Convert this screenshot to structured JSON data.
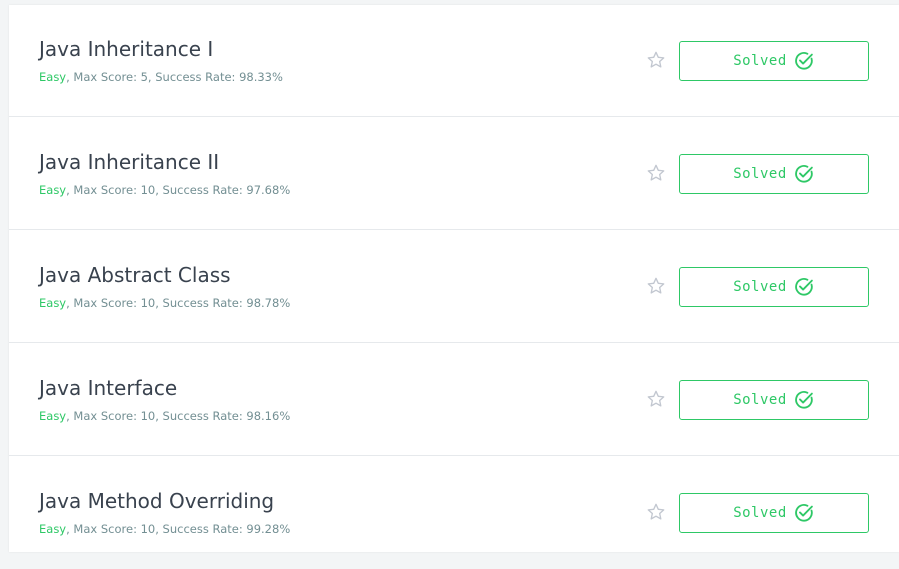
{
  "challenges": [
    {
      "title": "Java Inheritance I",
      "difficulty": "Easy",
      "details": ", Max Score: 5, Success Rate: 98.33%",
      "button_label": "Solved"
    },
    {
      "title": "Java Inheritance II",
      "difficulty": "Easy",
      "details": ", Max Score: 10, Success Rate: 97.68%",
      "button_label": "Solved"
    },
    {
      "title": "Java Abstract Class",
      "difficulty": "Easy",
      "details": ", Max Score: 10, Success Rate: 98.78%",
      "button_label": "Solved"
    },
    {
      "title": "Java Interface",
      "difficulty": "Easy",
      "details": ", Max Score: 10, Success Rate: 98.16%",
      "button_label": "Solved"
    },
    {
      "title": "Java Method Overriding",
      "difficulty": "Easy",
      "details": ", Max Score: 10, Success Rate: 99.28%",
      "button_label": "Solved"
    }
  ],
  "icons": {
    "star": "star-outline-icon",
    "check": "check-circle-icon"
  },
  "colors": {
    "accent": "#2ec866",
    "title": "#39424e",
    "meta": "#738f93",
    "star": "#c2c7d0",
    "divider": "#e6e9ec",
    "background": "#f3f5f6"
  }
}
